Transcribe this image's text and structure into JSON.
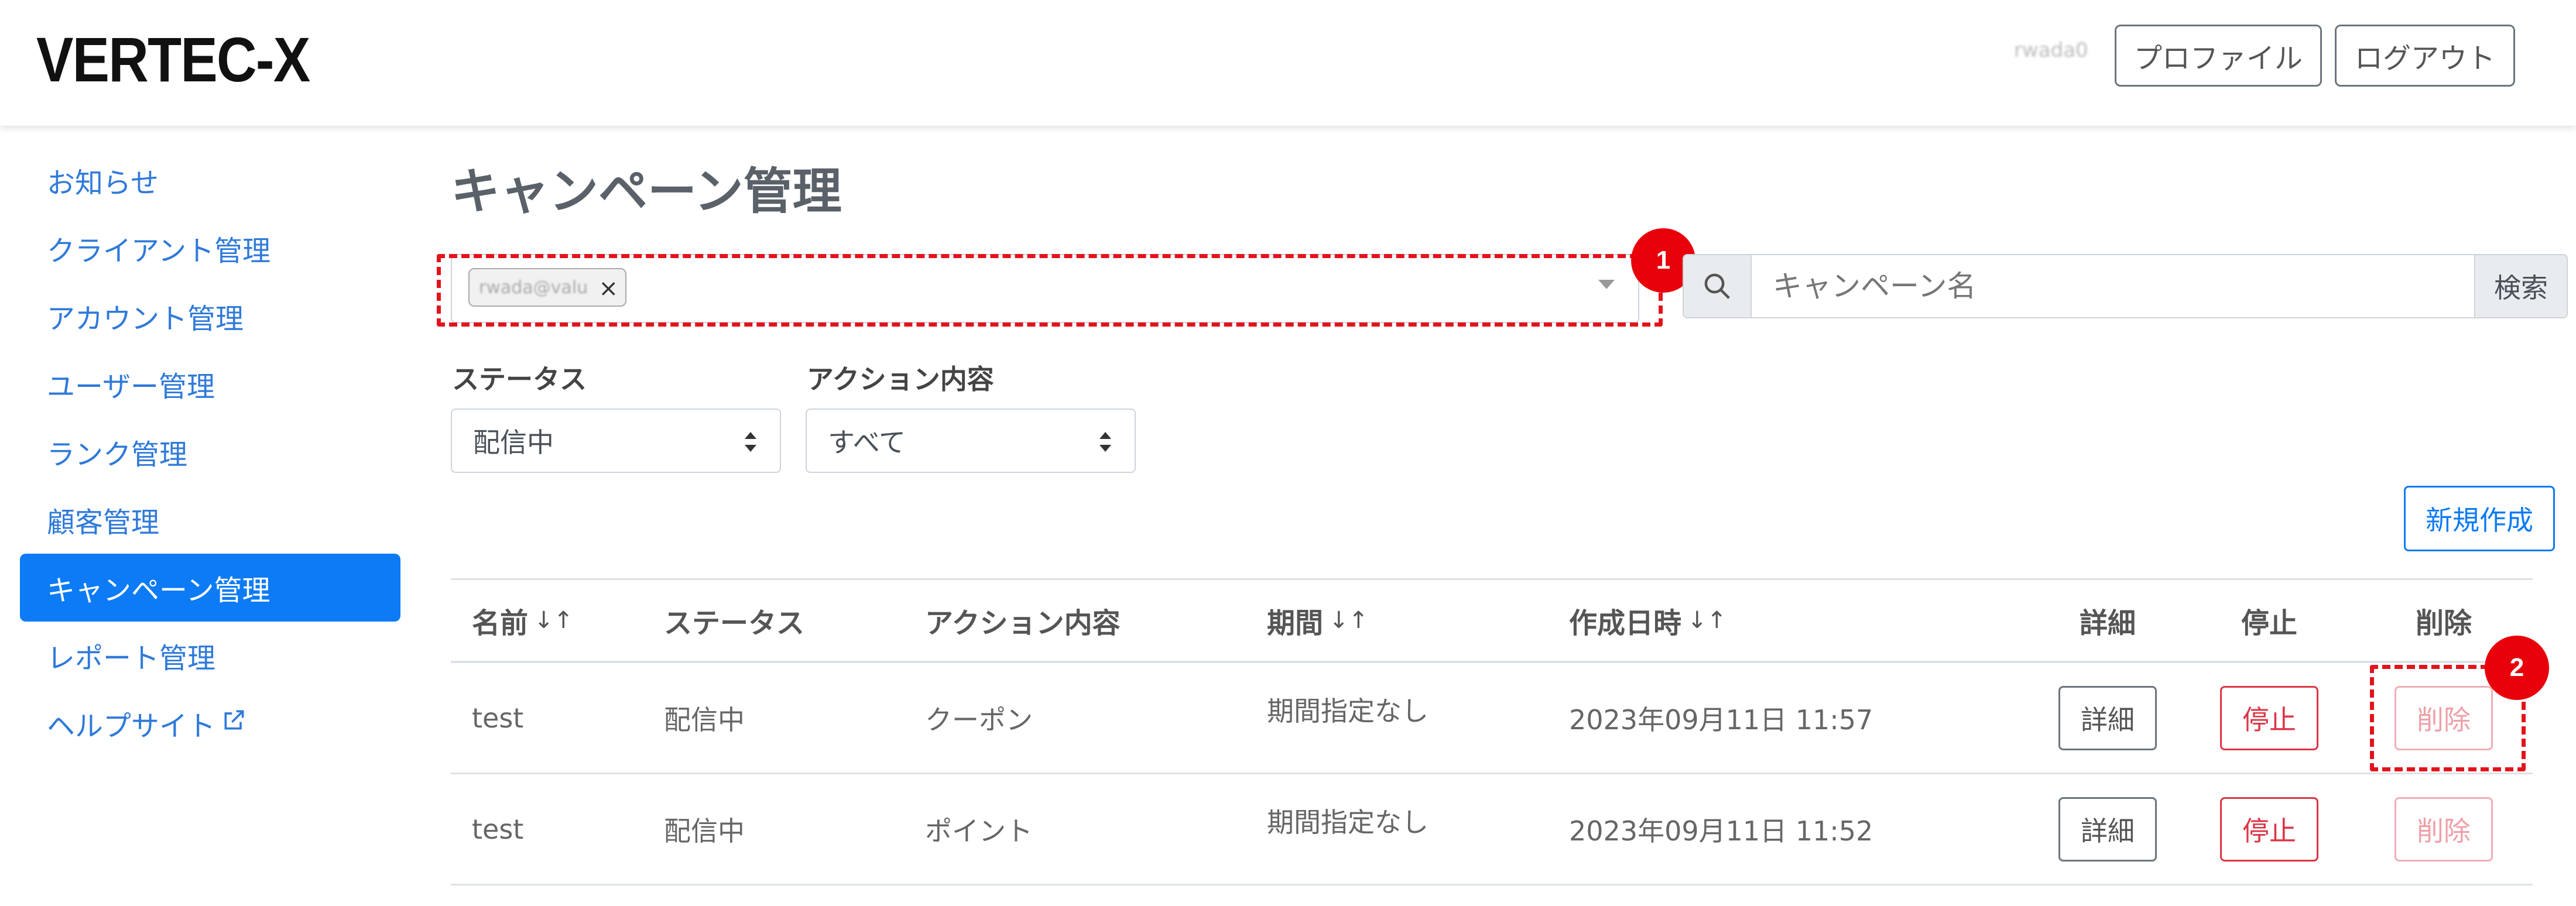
{
  "header": {
    "logo": "VERTEC-X",
    "user_name": "rwada0",
    "profile_label": "プロファイル",
    "logout_label": "ログアウト"
  },
  "sidebar": {
    "items": [
      {
        "label": "お知らせ",
        "active": false
      },
      {
        "label": "クライアント管理",
        "active": false
      },
      {
        "label": "アカウント管理",
        "active": false
      },
      {
        "label": "ユーザー管理",
        "active": false
      },
      {
        "label": "ランク管理",
        "active": false
      },
      {
        "label": "顧客管理",
        "active": false
      },
      {
        "label": "キャンペーン管理",
        "active": true
      },
      {
        "label": "レポート管理",
        "active": false
      },
      {
        "label": "ヘルプサイト",
        "active": false,
        "external": true
      }
    ]
  },
  "main": {
    "title": "キャンペーン管理",
    "client_filter": {
      "selected_tag": "rwada@valu",
      "remove_symbol": "×"
    },
    "search": {
      "placeholder": "キャンペーン名",
      "button_label": "検索"
    },
    "filters": {
      "status_label": "ステータス",
      "status_value": "配信中",
      "action_label": "アクション内容",
      "action_value": "すべて"
    },
    "new_button_label": "新規作成",
    "annotations": {
      "badge_1": "1",
      "badge_2": "2"
    },
    "table": {
      "headers": {
        "name": "名前",
        "status": "ステータス",
        "action": "アクション内容",
        "period": "期間",
        "created": "作成日時",
        "detail": "詳細",
        "stop": "停止",
        "delete": "削除"
      },
      "sort_symbol": "↓↑",
      "rows": [
        {
          "name": "test",
          "status": "配信中",
          "action": "クーポン",
          "period": "期間指定なし",
          "created": "2023年09月11日 11:57",
          "detail": "詳細",
          "stop": "停止",
          "delete": "削除"
        },
        {
          "name": "test",
          "status": "配信中",
          "action": "ポイント",
          "period": "期間指定なし",
          "created": "2023年09月11日 11:52",
          "detail": "詳細",
          "stop": "停止",
          "delete": "削除"
        }
      ]
    }
  },
  "colors": {
    "primary": "#0d7bf5",
    "danger": "#dc3545",
    "annotation_red": "#e3131b",
    "link": "#2f7ad9"
  }
}
